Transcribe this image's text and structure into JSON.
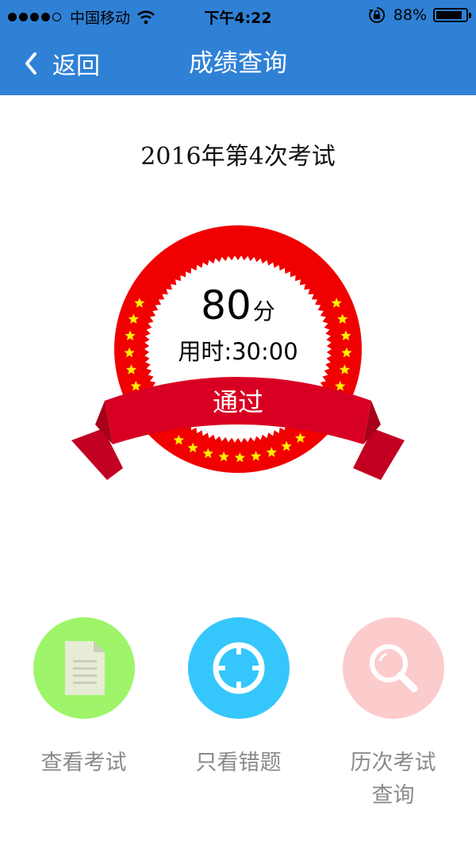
{
  "status_bar": {
    "carrier": "中国移动",
    "time": "下午4:22",
    "battery": "88%",
    "battery_level": 0.88
  },
  "nav": {
    "back_label": "返回",
    "title": "成绩查询"
  },
  "exam": {
    "title": "2016年第4次考试"
  },
  "result": {
    "score": "80",
    "score_unit": "分",
    "time_label": "用时:",
    "time_value": "30:00",
    "status": "通过"
  },
  "actions": [
    {
      "label": "查看考试",
      "icon": "document-icon",
      "color": "#9ff56a"
    },
    {
      "label": "只看错题",
      "icon": "crosshair-icon",
      "color": "#35c7fb"
    },
    {
      "label": "历次考试查询",
      "icon": "search-icon",
      "color": "#fccccd"
    }
  ],
  "colors": {
    "nav_bg": "#2f81d6",
    "badge_red": "#f00000",
    "ribbon_red": "#d80022",
    "star": "#ffee00"
  }
}
